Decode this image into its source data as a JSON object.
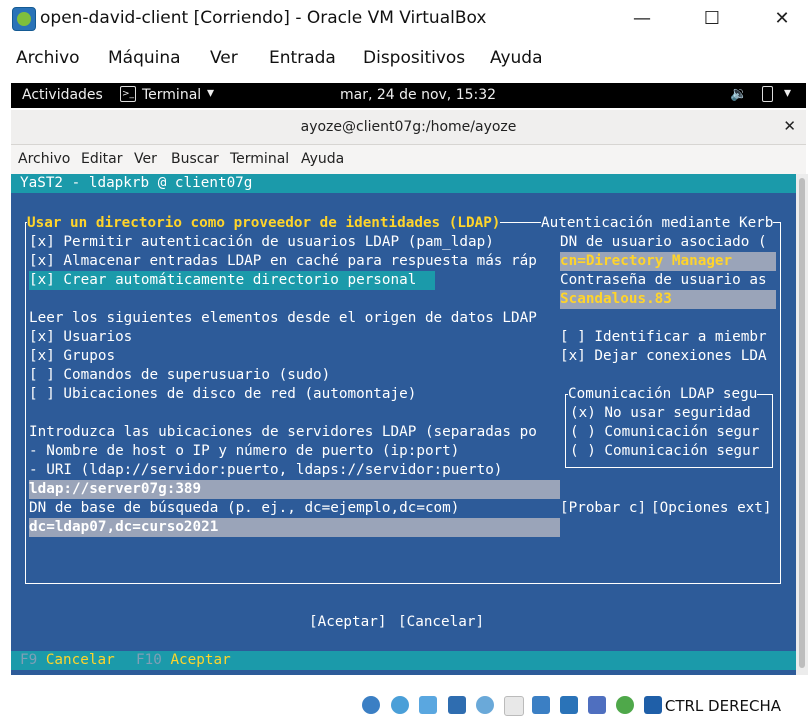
{
  "vbox": {
    "title": "open-david-client [Corriendo] - Oracle VM VirtualBox",
    "menu": [
      "Archivo",
      "Máquina",
      "Ver",
      "Entrada",
      "Dispositivos",
      "Ayuda"
    ],
    "host_key": "CTRL DERECHA"
  },
  "gnome": {
    "activities": "Actividades",
    "app": "Terminal",
    "clock": "mar, 24 de nov, 15:32"
  },
  "terminal": {
    "title": "ayoze@client07g:/home/ayoze",
    "menu": [
      "Archivo",
      "Editar",
      "Ver",
      "Buscar",
      "Terminal",
      "Ayuda"
    ]
  },
  "yast": {
    "header": "YaST2 - ldapkrb @ client07g",
    "ldap_frame_title": "Usar un directorio como proveedor de identidades (LDAP)",
    "kerb_frame_title": "Autenticación mediante Kerb",
    "chk_pam": "[x] Permitir autenticación de usuarios LDAP (pam_ldap)",
    "chk_cache": "[x] Almacenar entradas LDAP en caché para respuesta más ráp",
    "chk_home": "[x] Crear automáticamente directorio personal",
    "read_label": "Leer los siguientes elementos desde el origen de datos LDAP",
    "chk_users": "[x] Usuarios",
    "chk_groups": "[x] Grupos",
    "chk_sudo": "[ ] Comandos de superusuario (sudo)",
    "chk_automount": "[ ] Ubicaciones de disco de red (automontaje)",
    "servers_label": "Introduzca las ubicaciones de servidores LDAP (separadas po",
    "servers_hint1": "- Nombre de host o IP y número de puerto (ip:port)",
    "servers_hint2": "- URI (ldap://servidor:puerto, ldaps://servidor:puerto)",
    "servers_value": "ldap://server07g:389",
    "basedn_label": "DN de base de búsqueda (p. ej., dc=ejemplo,dc=com)",
    "basedn_value": "dc=ldap07,dc=curso2021",
    "binddn_label": "DN de usuario asociado (",
    "binddn_value": "cn=Directory Manager",
    "bindpw_label": "Contraseña de usuario as",
    "bindpw_value": "Scandalous.83",
    "chk_identify": "[ ] Identificar a miembr",
    "chk_keep": "[x] Dejar conexiones LDA",
    "comm_title": "Comunicación LDAP segu",
    "comm_opt1": "(x) No usar seguridad",
    "comm_opt2": "( ) Comunicación segur",
    "comm_opt3": "( ) Comunicación segur",
    "btn_test": "[Probar c]",
    "btn_ext": "[Opciones ext]",
    "btn_ok": "[Aceptar]",
    "btn_cancel": "[Cancelar]",
    "fkey1_key": "F9",
    "fkey1_label": "Cancelar",
    "fkey2_key": "F10",
    "fkey2_label": "Aceptar"
  },
  "colors": {
    "terminal_bg": "#2d5b99",
    "accent": "#1b9aaa",
    "hotkey": "#ffd42a",
    "field_bg": "#9aa4b9"
  }
}
